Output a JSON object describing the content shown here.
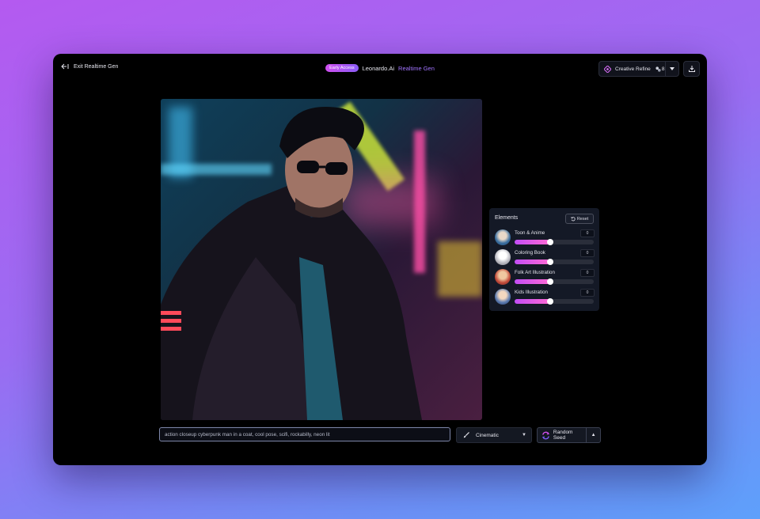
{
  "topbar": {
    "exit_label": "Exit Realtime Gen",
    "badge": "Early Access",
    "brand": "Leonardo.Ai",
    "product": "Realtime Gen",
    "refine_label": "Creative Refine",
    "refine_count": "8"
  },
  "elements": {
    "title": "Elements",
    "reset_label": "Reset",
    "items": [
      {
        "name": "Toon & Anime",
        "value": "0",
        "level": 0.45
      },
      {
        "name": "Coloring Book",
        "value": "0",
        "level": 0.45
      },
      {
        "name": "Folk Art Illustration",
        "value": "0",
        "level": 0.45
      },
      {
        "name": "Kids Illustration",
        "value": "0",
        "level": 0.45
      }
    ]
  },
  "prompt": {
    "value": "action closeup cyberpunk man in a coat, cool pose, scifi, rockabilly, neon lit"
  },
  "style": {
    "selected": "Cinematic"
  },
  "seed": {
    "label": "Random Seed"
  },
  "colors": {
    "accent": "#a274ff",
    "slider_start": "#c24df5",
    "slider_end": "#ff6ad5"
  }
}
